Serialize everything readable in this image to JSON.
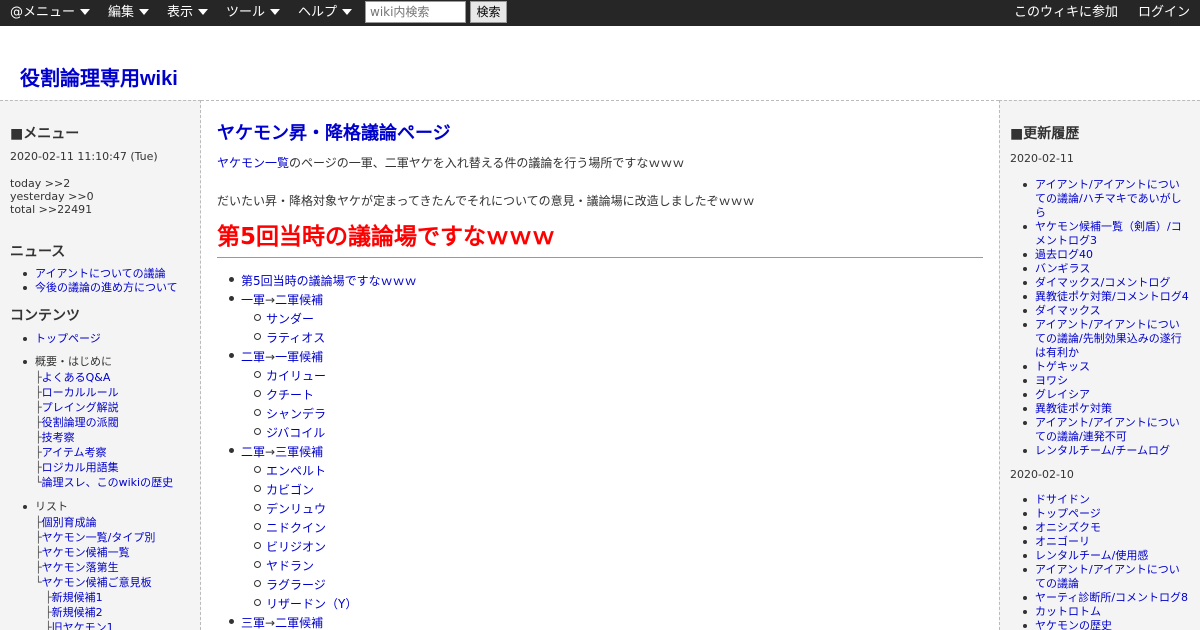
{
  "topbar": {
    "menus": [
      "@メニュー",
      "編集",
      "表示",
      "ツール",
      "ヘルプ"
    ],
    "search_placeholder": "wiki内検索",
    "search_button": "検索",
    "join": "このウィキに参加",
    "login": "ログイン"
  },
  "site_title": "役割論理専用wiki",
  "left": {
    "menu_heading": "■メニュー",
    "datetime": "2020-02-11 11:10:47 (Tue)",
    "counter_today": "today >>2",
    "counter_yesterday": "yesterday >>0",
    "counter_total": "total >>22491",
    "news_heading": "ニュース",
    "news_items": [
      "アイアントについての議論",
      "今後の議論の進め方について"
    ],
    "contents_heading": "コンテンツ",
    "top_page": "トップページ",
    "overview_label": "概要・はじめに",
    "overview_items": [
      {
        "branch": "├",
        "label": "よくあるQ&A"
      },
      {
        "branch": "├",
        "label": "ローカルルール"
      },
      {
        "branch": "├",
        "label": "プレイング解説"
      },
      {
        "branch": "├",
        "label": "役割論理の派閥"
      },
      {
        "branch": "├",
        "label": "技考察"
      },
      {
        "branch": "├",
        "label": "アイテム考察"
      },
      {
        "branch": "├",
        "label": "ロジカル用語集"
      },
      {
        "branch": "└",
        "label": "論理スレ、このwikiの歴史"
      }
    ],
    "list_label": "リスト",
    "list_items": [
      {
        "branch": "├",
        "label": "個別育成論"
      },
      {
        "branch": "├",
        "label": "ヤケモン一覧/タイプ別"
      },
      {
        "branch": "├",
        "label": "ヤケモン候補一覧"
      },
      {
        "branch": "├",
        "label": "ヤケモン落第生"
      },
      {
        "branch": "└",
        "label": "ヤケモン候補ご意見板"
      }
    ],
    "sub_items": [
      {
        "branch": "├",
        "label": "新規候補1"
      },
      {
        "branch": "├",
        "label": "新規候補2"
      },
      {
        "branch": "├",
        "label": "旧ヤケモン1"
      }
    ]
  },
  "main": {
    "page_title": "ヤケモン昇・降格議論ページ",
    "intro1_link": "ヤケモン一覧",
    "intro1_rest": "のページの一軍、二軍ヤケを入れ替える件の議論を行う場所ですなｗｗｗ",
    "intro2": "だいたい昇・降格対象ヤケが定まってきたんでそれについての意見・議論場に改造しましたぞｗｗｗ",
    "big_heading": "第5回当時の議論場ですなｗｗｗ",
    "toc": [
      {
        "level": 1,
        "text": "第5回当時の議論場ですなｗｗｗ"
      },
      {
        "level": 1,
        "a": "一軍",
        "arrow": "→",
        "b": "二軍候補"
      },
      {
        "level": 2,
        "text": "サンダー"
      },
      {
        "level": 2,
        "text": "ラティオス"
      },
      {
        "level": 1,
        "a": "二軍",
        "arrow": "→",
        "b": "一軍候補"
      },
      {
        "level": 2,
        "text": "カイリュー"
      },
      {
        "level": 2,
        "text": "クチート"
      },
      {
        "level": 2,
        "text": "シャンデラ"
      },
      {
        "level": 2,
        "text": "ジバコイル"
      },
      {
        "level": 1,
        "a": "二軍",
        "arrow": "→",
        "b": "三軍候補"
      },
      {
        "level": 2,
        "text": "エンペルト"
      },
      {
        "level": 2,
        "text": "カビゴン"
      },
      {
        "level": 2,
        "text": "デンリュウ"
      },
      {
        "level": 2,
        "text": "ニドクイン"
      },
      {
        "level": 2,
        "text": "ビリジオン"
      },
      {
        "level": 2,
        "text": "ヤドラン"
      },
      {
        "level": 2,
        "text": "ラグラージ"
      },
      {
        "level": 2,
        "text": "リザードン（Y）"
      },
      {
        "level": 1,
        "a": "三軍",
        "arrow": "→",
        "b": "二軍候補"
      }
    ]
  },
  "right": {
    "heading": "■更新履歴",
    "date1": "2020-02-11",
    "items1": [
      [
        "アイアント/アイアントについ",
        "ての議論/ハチマキであいがし",
        "ら"
      ],
      [
        "ヤケモン候補一覧（剣盾）/コ",
        "メントログ3"
      ],
      [
        "過去ログ40"
      ],
      [
        "バンギラス"
      ],
      [
        "ダイマックス/コメントログ"
      ],
      [
        "異教徒ポケ対策/コメントログ4"
      ],
      [
        "ダイマックス"
      ],
      [
        "アイアント/アイアントについ",
        "ての議論/先制効果込みの遂行",
        "は有利か"
      ],
      [
        "トゲキッス"
      ],
      [
        "ヨワシ"
      ],
      [
        "グレイシア"
      ],
      [
        "異教徒ポケ対策"
      ],
      [
        "アイアント/アイアントについ",
        "ての議論/連発不可"
      ],
      [
        "レンタルチーム/チームログ"
      ]
    ],
    "date2": "2020-02-10",
    "items2": [
      [
        "ドサイドン"
      ],
      [
        "トップページ"
      ],
      [
        "オニシズクモ"
      ],
      [
        "オニゴーリ"
      ],
      [
        "レンタルチーム/使用感"
      ],
      [
        "アイアント/アイアントについ",
        "ての議論"
      ],
      [
        "ヤーティ診断所/コメントログ8"
      ],
      [
        "カットロトム"
      ],
      [
        "ヤケモンの歴史"
      ]
    ]
  }
}
